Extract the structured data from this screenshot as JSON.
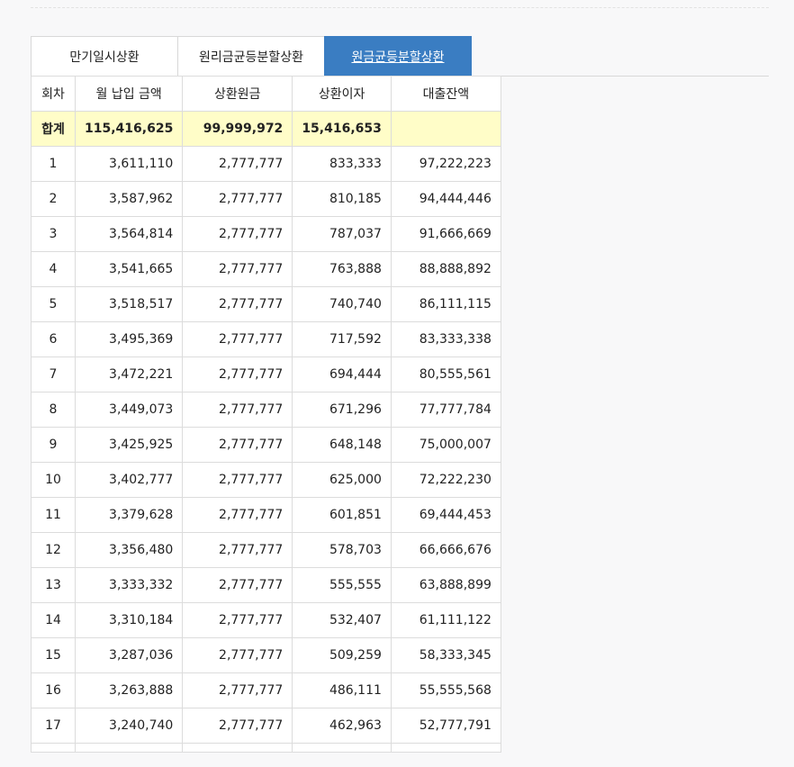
{
  "tabs": [
    {
      "label": "만기일시상환",
      "active": false
    },
    {
      "label": "원리금균등분할상환",
      "active": false
    },
    {
      "label": "원금균등분할상환",
      "active": true
    }
  ],
  "table": {
    "headers": [
      "회차",
      "월 납입 금액",
      "상환원금",
      "상환이자",
      "대출잔액"
    ],
    "total": {
      "label": "합계",
      "payment": "115,416,625",
      "principal": "99,999,972",
      "interest": "15,416,653",
      "balance": ""
    },
    "rows": [
      [
        "1",
        "3,611,110",
        "2,777,777",
        "833,333",
        "97,222,223"
      ],
      [
        "2",
        "3,587,962",
        "2,777,777",
        "810,185",
        "94,444,446"
      ],
      [
        "3",
        "3,564,814",
        "2,777,777",
        "787,037",
        "91,666,669"
      ],
      [
        "4",
        "3,541,665",
        "2,777,777",
        "763,888",
        "88,888,892"
      ],
      [
        "5",
        "3,518,517",
        "2,777,777",
        "740,740",
        "86,111,115"
      ],
      [
        "6",
        "3,495,369",
        "2,777,777",
        "717,592",
        "83,333,338"
      ],
      [
        "7",
        "3,472,221",
        "2,777,777",
        "694,444",
        "80,555,561"
      ],
      [
        "8",
        "3,449,073",
        "2,777,777",
        "671,296",
        "77,777,784"
      ],
      [
        "9",
        "3,425,925",
        "2,777,777",
        "648,148",
        "75,000,007"
      ],
      [
        "10",
        "3,402,777",
        "2,777,777",
        "625,000",
        "72,222,230"
      ],
      [
        "11",
        "3,379,628",
        "2,777,777",
        "601,851",
        "69,444,453"
      ],
      [
        "12",
        "3,356,480",
        "2,777,777",
        "578,703",
        "66,666,676"
      ],
      [
        "13",
        "3,333,332",
        "2,777,777",
        "555,555",
        "63,888,899"
      ],
      [
        "14",
        "3,310,184",
        "2,777,777",
        "532,407",
        "61,111,122"
      ],
      [
        "15",
        "3,287,036",
        "2,777,777",
        "509,259",
        "58,333,345"
      ],
      [
        "16",
        "3,263,888",
        "2,777,777",
        "486,111",
        "55,555,568"
      ],
      [
        "17",
        "3,240,740",
        "2,777,777",
        "462,963",
        "52,777,791"
      ]
    ]
  },
  "colors": {
    "active_tab": "#3a7dc2",
    "total_row": "#fffdc8",
    "border": "#dcdcdc",
    "background": "#f8f8f9"
  }
}
